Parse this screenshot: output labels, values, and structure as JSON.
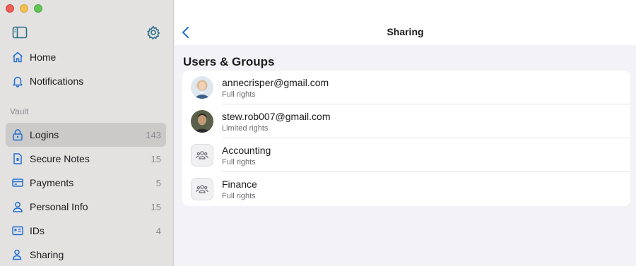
{
  "window": {
    "traffic_lights": [
      "close",
      "minimize",
      "zoom"
    ]
  },
  "sidebar": {
    "toggle_icon": "sidebar-toggle-icon",
    "settings_icon": "gear-icon",
    "top_items": [
      {
        "label": "Home",
        "icon": "home-icon"
      },
      {
        "label": "Notifications",
        "icon": "bell-icon"
      }
    ],
    "section_label": "Vault",
    "vault_items": [
      {
        "label": "Logins",
        "count": "143",
        "icon": "lock-icon",
        "selected": true
      },
      {
        "label": "Secure Notes",
        "count": "15",
        "icon": "note-icon"
      },
      {
        "label": "Payments",
        "count": "5",
        "icon": "card-icon"
      },
      {
        "label": "Personal Info",
        "count": "15",
        "icon": "person-icon"
      },
      {
        "label": "IDs",
        "count": "4",
        "icon": "id-card-icon"
      },
      {
        "label": "Sharing",
        "count": "",
        "icon": "sharing-icon"
      }
    ]
  },
  "main": {
    "title": "Sharing",
    "back_icon": "chevron-left-icon",
    "section_heading": "Users & Groups",
    "entries": [
      {
        "name": "annecrisper@gmail.com",
        "rights": "Full rights",
        "kind": "user"
      },
      {
        "name": "stew.rob007@gmail.com",
        "rights": "Limited rights",
        "kind": "user"
      },
      {
        "name": "Accounting",
        "rights": "Full rights",
        "kind": "group"
      },
      {
        "name": "Finance",
        "rights": "Full rights",
        "kind": "group"
      }
    ]
  },
  "colors": {
    "accent": "#1f6fd1",
    "sidebar_bg": "#e3e2e1",
    "selected_bg": "#cbcac9",
    "content_bg": "#f2f2f7",
    "gear_teal": "#2a6f86"
  }
}
